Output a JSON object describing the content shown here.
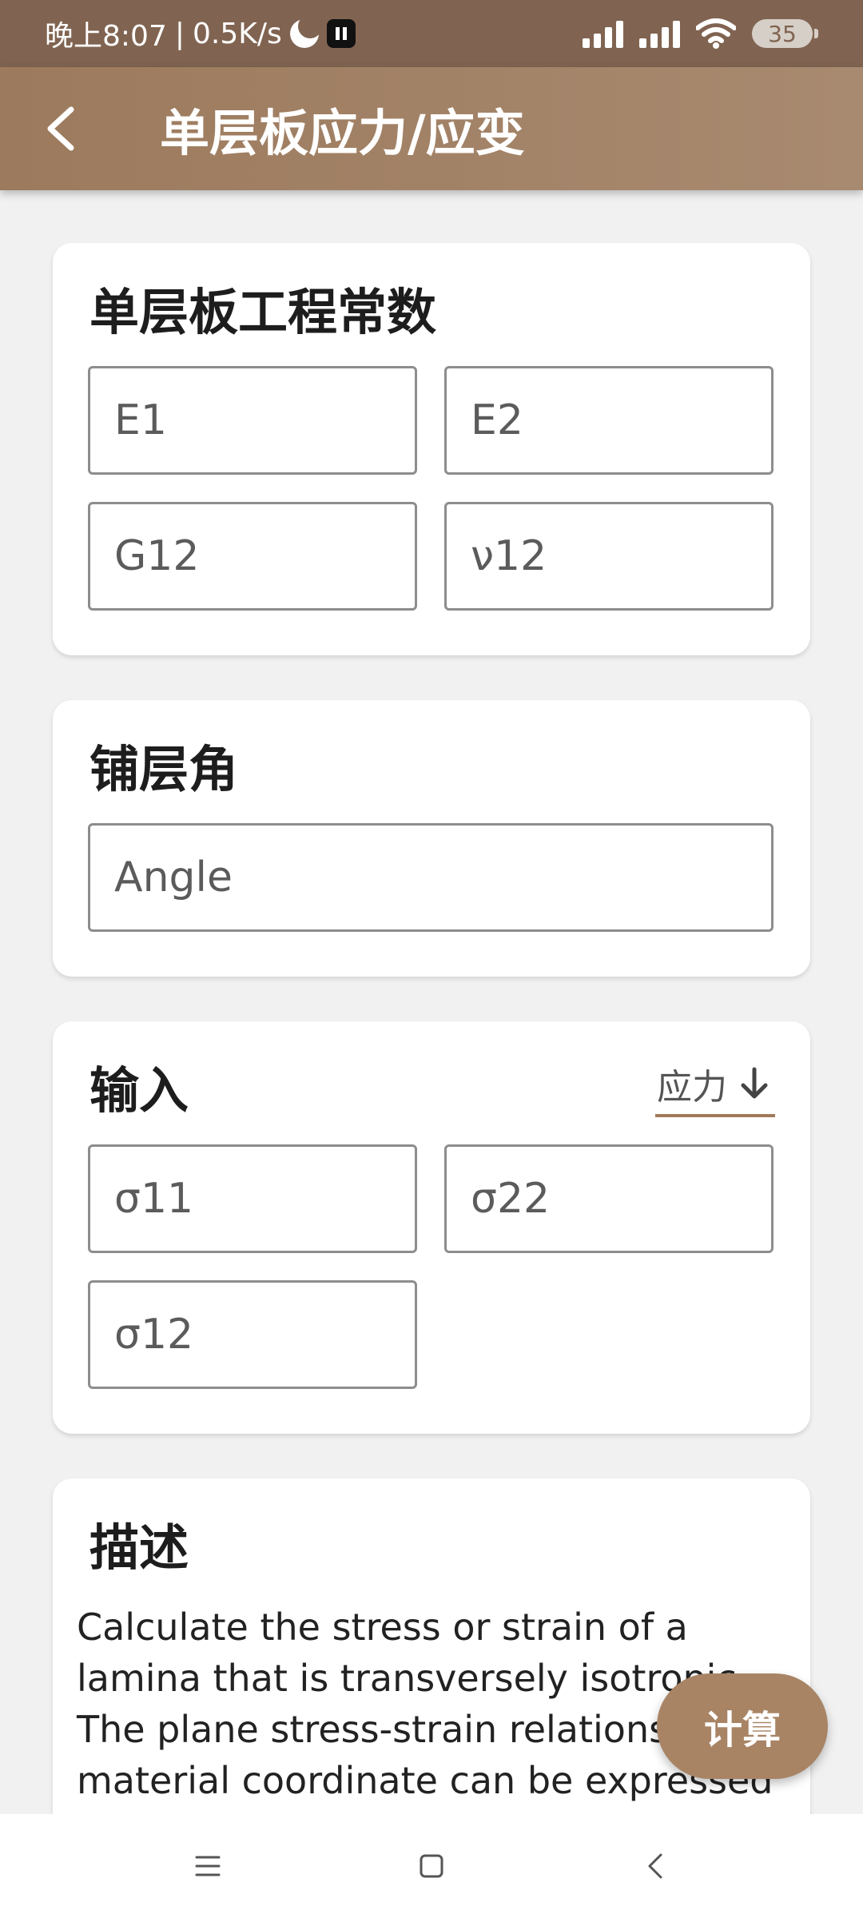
{
  "status": {
    "time": "晚上8:07",
    "separator": "|",
    "speed": "0.5K/s",
    "battery": "35"
  },
  "app_bar": {
    "title": "单层板应力/应变"
  },
  "engineering_constants": {
    "title": "单层板工程常数",
    "e1_placeholder": "E1",
    "e2_placeholder": "E2",
    "g12_placeholder": "G12",
    "v12_placeholder": "ν12"
  },
  "ply_angle": {
    "title": "铺层角",
    "angle_placeholder": "Angle"
  },
  "input_section": {
    "title": "输入",
    "mode_label": "应力",
    "sigma11_placeholder": "σ11",
    "sigma22_placeholder": "σ22",
    "sigma12_placeholder": "σ12"
  },
  "description": {
    "title": "描述",
    "text": "Calculate the stress or strain of a lamina that is transversely isotropic. The plane stress-strain relations of material coordinate can be expressed"
  },
  "fab": {
    "label": "计算"
  },
  "colors": {
    "status_bar": "#806451",
    "app_bar": "#a88a70",
    "accent": "#a07a5a",
    "fab": "#a88465"
  }
}
